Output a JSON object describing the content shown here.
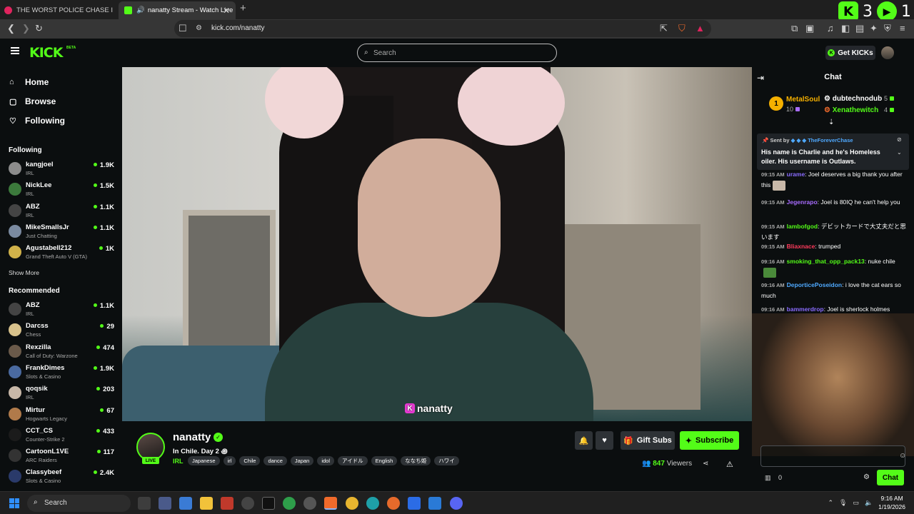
{
  "browser": {
    "tabs": [
      {
        "title": "THE WORST POLICE CHASE I'VE EVER",
        "favicon_color": "#e0245e"
      },
      {
        "title": "nanatty Stream - Watch Live",
        "favicon_color": "#53fc18"
      }
    ],
    "url": "kick.com/nanatty",
    "ext_counts": {
      "kick": "3",
      "play": "1"
    }
  },
  "header": {
    "logo": "KICK",
    "logo_badge": "BETA",
    "search_placeholder": "Search",
    "get_kicks": "Get KICKs"
  },
  "sidebar": {
    "nav": [
      {
        "label": "Home",
        "icon": "home-icon"
      },
      {
        "label": "Browse",
        "icon": "browse-icon"
      },
      {
        "label": "Following",
        "icon": "heart-icon"
      }
    ],
    "following_title": "Following",
    "following": [
      {
        "name": "kangjoel",
        "category": "IRL",
        "viewers": "1.9K",
        "color": "#8c8c8c"
      },
      {
        "name": "NickLee",
        "category": "IRL",
        "viewers": "1.5K",
        "color": "#3c7a3c"
      },
      {
        "name": "ABZ",
        "category": "IRL",
        "viewers": "1.1K",
        "color": "#444"
      },
      {
        "name": "MikeSmallsJr",
        "category": "Just Chatting",
        "viewers": "1.1K",
        "color": "#7a8aa0"
      },
      {
        "name": "Agustabell212",
        "category": "Grand Theft Auto V (GTA)",
        "viewers": "1K",
        "color": "#d1b24a"
      }
    ],
    "show_more": "Show More",
    "recommended_title": "Recommended",
    "recommended": [
      {
        "name": "ABZ",
        "category": "IRL",
        "viewers": "1.1K",
        "color": "#444"
      },
      {
        "name": "Darcss",
        "category": "Chess",
        "viewers": "29",
        "color": "#d8c28c"
      },
      {
        "name": "Rexzilla",
        "category": "Call of Duty: Warzone",
        "viewers": "474",
        "color": "#6a5a4a"
      },
      {
        "name": "FrankDimes",
        "category": "Slots & Casino",
        "viewers": "1.9K",
        "color": "#4a6aa0"
      },
      {
        "name": "qoqsik",
        "category": "IRL",
        "viewers": "203",
        "color": "#c8b8a8"
      },
      {
        "name": "Mirtur",
        "category": "Hogwarts Legacy",
        "viewers": "67",
        "color": "#b07a4a"
      },
      {
        "name": "CCT_CS",
        "category": "Counter-Strike 2",
        "viewers": "433",
        "color": "#1b1b1b"
      },
      {
        "name": "CartoonL1VE",
        "category": "ARC Raiders",
        "viewers": "117",
        "color": "#333"
      },
      {
        "name": "Classybeef",
        "category": "Slots & Casino",
        "viewers": "2.4K",
        "color": "#2a3a6a"
      }
    ]
  },
  "video": {
    "watermark": "nanatty"
  },
  "stream": {
    "name": "nanatty",
    "title": "In Chile. Day 2 ꩜",
    "category": "IRL",
    "tags": [
      "Japanese",
      "irl",
      "Chile",
      "dance",
      "Japan",
      "idol",
      "アイドル",
      "English",
      "ななち姫",
      "ハワイ"
    ],
    "live_label": "LIVE",
    "gift_subs": "Gift Subs",
    "subscribe": "Subscribe",
    "viewers": "847",
    "viewers_label": "Viewers"
  },
  "chat": {
    "title": "Chat",
    "leaderboard": [
      {
        "rank": "1",
        "name": "MetalSoul",
        "count": "10",
        "color": "#f5b000"
      },
      {
        "name": "dubtechnodub",
        "count": "5",
        "color": "#ffffff"
      },
      {
        "name": "Xenathewitch",
        "count": "4",
        "color": "#53fc18"
      }
    ],
    "pinned": {
      "sent_by": "Sent by",
      "user": "TheForeverChase",
      "message": "His name is Charlie and he's Homeless oiler. His username is Outlaws."
    },
    "messages": [
      {
        "time": "09:15 AM",
        "user": "urame",
        "text": ": Joel deserves a big thank you after this",
        "color": "#8a6cff"
      },
      {
        "time": "09:15 AM",
        "user": "Jegenrapo",
        "text": ": Joel is 80IQ he can't help you",
        "color": "#a86cff"
      },
      {
        "time": "09:15 AM",
        "user": "lambofgod",
        "text": ": デビットカードで大丈夫だと思います",
        "color": "#53fc18"
      },
      {
        "time": "09:15 AM",
        "user": "Bliaxnace",
        "text": ": trumped",
        "color": "#ff3b5c"
      },
      {
        "time": "09:16 AM",
        "user": "smoking_that_opp_pack13",
        "text": ": nuke chile",
        "color": "#53fc18"
      },
      {
        "time": "09:16 AM",
        "user": "DeporticePoseidon",
        "text": ": i love the cat ears so much",
        "color": "#4fa9ff"
      },
      {
        "time": "09:16 AM",
        "user": "bammerdrop",
        "text": ": Joel is sherlock holmes",
        "color": "#8a6cff"
      }
    ],
    "send": "Chat",
    "kicks_count": "0"
  },
  "taskbar": {
    "search": "Search",
    "time": "9:16 AM",
    "date": "1/19/2026"
  }
}
